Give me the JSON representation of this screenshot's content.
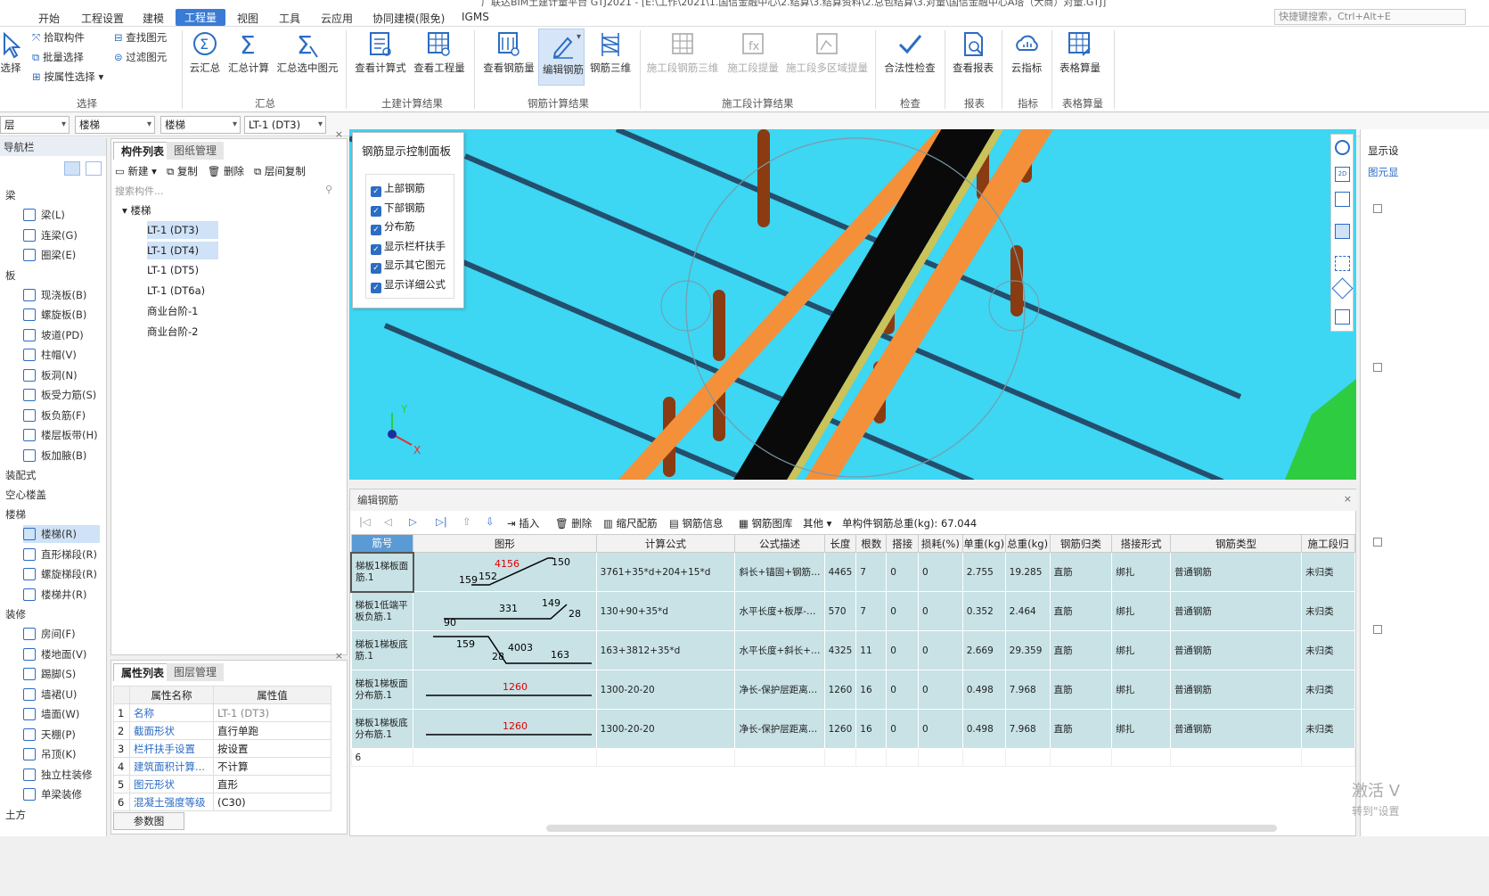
{
  "title": "广联达BIM土建计量平台 GTJ2021 - [E:\\工作\\2021\\1.国信金融中心\\2.结算\\3.结算资料\\2.总包结算\\3.对量\\国信金融中心A塔（大商）对量.GTJ]",
  "menu": [
    "开始",
    "工程设置",
    "建模",
    "工程量",
    "视图",
    "工具",
    "云应用",
    "协同建模(限免)",
    "IGMS"
  ],
  "menu_active": "工程量",
  "quick_search": "快捷键搜索，Ctrl+Alt+E",
  "ribbon": {
    "select_group": {
      "label": "选择",
      "btn": "选择",
      "items": [
        "拾取构件",
        "批量选择",
        "按属性选择",
        "查找图元",
        "过滤图元"
      ]
    },
    "summary_group": {
      "label": "汇总",
      "items": [
        "云汇总",
        "汇总计算",
        "汇总选中图元"
      ]
    },
    "civil_group": {
      "label": "土建计算结果",
      "items": [
        "查看计算式",
        "查看工程量"
      ]
    },
    "rebar_group": {
      "label": "钢筋计算结果",
      "items": [
        "查看钢筋量",
        "编辑钢筋",
        "钢筋三维"
      ]
    },
    "construction_group": {
      "label": "施工段计算结果",
      "items": [
        "施工段钢筋三维",
        "施工段提量",
        "施工段多区域提量"
      ]
    },
    "check_group": {
      "label": "检查",
      "items": [
        "合法性检查"
      ]
    },
    "report_group": {
      "label": "报表",
      "items": [
        "查看报表"
      ]
    },
    "index_group": {
      "label": "指标",
      "items": [
        "云指标"
      ]
    },
    "table_group": {
      "label": "表格算量",
      "items": [
        "表格算量"
      ]
    }
  },
  "selectors": [
    "层",
    "楼梯",
    "楼梯",
    "LT-1 (DT3)"
  ],
  "nav": {
    "title": "导航栏",
    "categories": [
      {
        "name": "梁",
        "items": [
          "梁(L)",
          "连梁(G)",
          "圈梁(E)"
        ]
      },
      {
        "name": "板",
        "items": [
          "现浇板(B)",
          "螺旋板(B)",
          "坡道(PD)",
          "柱帽(V)",
          "板洞(N)",
          "板受力筋(S)",
          "板负筋(F)",
          "楼层板带(H)",
          "板加腋(B)"
        ]
      },
      {
        "name": "装配式",
        "items": []
      },
      {
        "name": "空心楼盖",
        "items": []
      },
      {
        "name": "楼梯",
        "items": [
          "楼梯(R)",
          "直形梯段(R)",
          "螺旋梯段(R)",
          "楼梯井(R)"
        ]
      },
      {
        "name": "装修",
        "items": [
          "房间(F)",
          "楼地面(V)",
          "踢脚(S)",
          "墙裙(U)",
          "墙面(W)",
          "天棚(P)",
          "吊顶(K)",
          "独立柱装修",
          "单梁装修"
        ]
      },
      {
        "name": "土方",
        "items": []
      }
    ],
    "selected": "楼梯(R)"
  },
  "components": {
    "tabs": [
      "构件列表",
      "图纸管理"
    ],
    "toolbar": [
      "新建",
      "复制",
      "删除",
      "层间复制"
    ],
    "search_placeholder": "搜索构件...",
    "group": "楼梯",
    "items": [
      "LT-1 (DT3)",
      "LT-1 (DT4)",
      "LT-1 (DT5)",
      "LT-1 (DT6a)",
      "商业台阶-1",
      "商业台阶-2"
    ]
  },
  "properties": {
    "tabs": [
      "属性列表",
      "图层管理"
    ],
    "headers": [
      "属性名称",
      "属性值"
    ],
    "rows": [
      [
        "1",
        "名称",
        "LT-1 (DT3)"
      ],
      [
        "2",
        "截面形状",
        "直行单跑"
      ],
      [
        "3",
        "栏杆扶手设置",
        "按设置"
      ],
      [
        "4",
        "建筑面积计算...",
        "不计算"
      ],
      [
        "5",
        "图元形状",
        "直形"
      ],
      [
        "6",
        "混凝土强度等级",
        "(C30)"
      ]
    ],
    "button": "参数图"
  },
  "rebar_panel": {
    "title": "钢筋显示控制面板",
    "options": [
      "上部钢筋",
      "下部钢筋",
      "分布筋",
      "显示栏杆扶手",
      "显示其它图元",
      "显示详细公式"
    ]
  },
  "edit_rebar": {
    "title": "编辑钢筋",
    "toolbar": [
      "插入",
      "删除",
      "缩尺配筋",
      "钢筋信息",
      "钢筋图库",
      "其他"
    ],
    "total_weight_label": "单构件钢筋总重(kg): 67.044",
    "headers": [
      "筋号",
      "图形",
      "计算公式",
      "公式描述",
      "长度",
      "根数",
      "搭接",
      "损耗(%)",
      "单重(kg)",
      "总重(kg)",
      "钢筋归类",
      "搭接形式",
      "钢筋类型",
      "施工段归"
    ],
    "rows": [
      {
        "no": "1",
        "name": "梯板1梯板面筋.1",
        "shape": {
          "a": "159",
          "b": "152",
          "c": "4156",
          "d": "150"
        },
        "formula": "3761+35*d+204+15*d",
        "desc": "斜长+锚固+钢筋…",
        "len": "4465",
        "count": "7",
        "lap": "0",
        "loss": "0",
        "unit": "2.755",
        "total": "19.285",
        "cls": "直筋",
        "laptype": "绑扎",
        "type": "普通钢筋",
        "stage": "未归类"
      },
      {
        "no": "2",
        "name": "梯板1低端平板负筋.1",
        "shape": {
          "a": "90",
          "b": "331",
          "c": "149",
          "d": "28"
        },
        "formula": "130+90+35*d",
        "desc": "水平长度+板厚-…",
        "len": "570",
        "count": "7",
        "lap": "0",
        "loss": "0",
        "unit": "0.352",
        "total": "2.464",
        "cls": "直筋",
        "laptype": "绑扎",
        "type": "普通钢筋",
        "stage": "未归类"
      },
      {
        "no": "3",
        "name": "梯板1梯板底筋.1",
        "shape": {
          "a": "159",
          "b": "28",
          "c": "4003",
          "d": "163"
        },
        "formula": "163+3812+35*d",
        "desc": "水平长度+斜长+…",
        "len": "4325",
        "count": "11",
        "lap": "0",
        "loss": "0",
        "unit": "2.669",
        "total": "29.359",
        "cls": "直筋",
        "laptype": "绑扎",
        "type": "普通钢筋",
        "stage": "未归类"
      },
      {
        "no": "4",
        "name": "梯板1梯板面分布筋.1",
        "shape": {
          "c": "1260"
        },
        "formula": "1300-20-20",
        "desc": "净长-保护层距离…",
        "len": "1260",
        "count": "16",
        "lap": "0",
        "loss": "0",
        "unit": "0.498",
        "total": "7.968",
        "cls": "直筋",
        "laptype": "绑扎",
        "type": "普通钢筋",
        "stage": "未归类"
      },
      {
        "no": "5",
        "name": "梯板1梯板底分布筋.1",
        "shape": {
          "c": "1260"
        },
        "formula": "1300-20-20",
        "desc": "净长-保护层距离…",
        "len": "1260",
        "count": "16",
        "lap": "0",
        "loss": "0",
        "unit": "0.498",
        "total": "7.968",
        "cls": "直筋",
        "laptype": "绑扎",
        "type": "普通钢筋",
        "stage": "未归类"
      }
    ],
    "empty_row": "6"
  },
  "right_panel": {
    "title": "显示设",
    "tab": "图元显"
  },
  "watermark": {
    "line1": "激活 V",
    "line2": "转到\"设置"
  }
}
